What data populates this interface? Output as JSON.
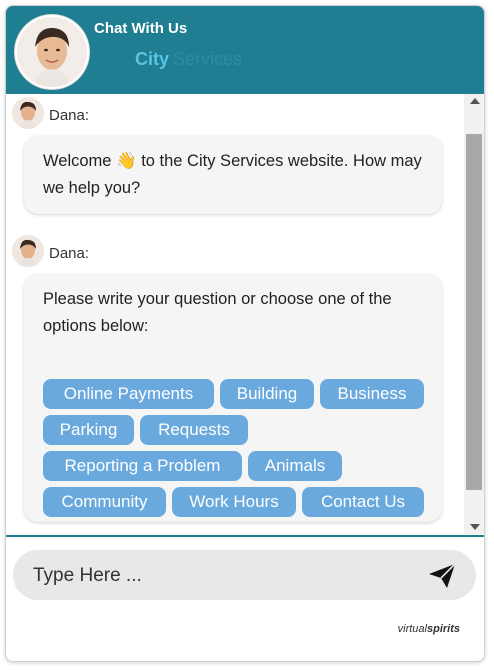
{
  "header": {
    "title": "Chat With Us",
    "brand_primary": "City",
    "brand_secondary": "Services"
  },
  "messages": [
    {
      "sender": "Dana:",
      "text_before_emoji": "Welcome ",
      "emoji": "👋",
      "text_after_emoji": " to the City Services website. How may we help you?"
    },
    {
      "sender": "Dana:",
      "text": "Please write your question or choose one of the options below:",
      "options": [
        "Online Payments",
        "Building",
        "Business",
        "Parking",
        "Requests",
        "Reporting a Problem",
        "Animals",
        "Community",
        "Work Hours",
        "Contact Us"
      ]
    }
  ],
  "input": {
    "placeholder": "Type Here ..."
  },
  "footer": {
    "brand_light": "virtual",
    "brand_bold": "spirits"
  },
  "colors": {
    "header": "#1f7e91",
    "option": "#6aa9dd",
    "bubble": "#f5f5f5"
  },
  "icons": {
    "send": "paper-plane-icon",
    "scroll_up": "triangle-up-icon",
    "scroll_down": "triangle-down-icon"
  }
}
